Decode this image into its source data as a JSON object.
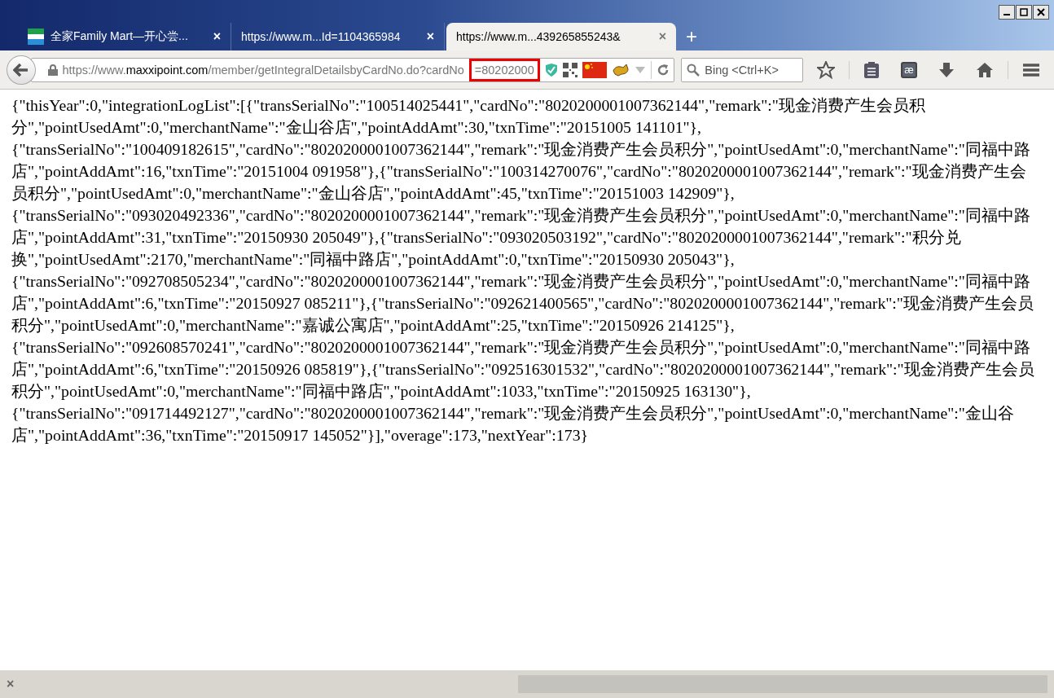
{
  "window": {
    "controls": [
      {
        "kind": "minimize"
      },
      {
        "kind": "maximize"
      },
      {
        "kind": "close"
      }
    ]
  },
  "tabs": [
    {
      "title": "全家Family Mart—开心尝...",
      "close": "×",
      "selected": false,
      "kind": "favicon"
    },
    {
      "title": "https://www.m...Id=1104365984",
      "close": "×",
      "selected": false,
      "kind": "plain"
    },
    {
      "title": "https://www.m...439265855243&",
      "close": "×",
      "selected": true,
      "kind": "plain"
    }
  ],
  "new_tab": "+",
  "address_bar": {
    "scheme": "https://www.",
    "host": "maxxipoint.com",
    "path": "/member/getIntegralDetailsbyCardNo.do?cardNo",
    "highlighted": "=80202000"
  },
  "search": {
    "placeholder": "Bing <Ctrl+K>"
  },
  "toolbar": {
    "addon_glyph": "æ"
  },
  "page_lines": [
    "{\"thisYear\":0,\"integrationLogList\":[{\"transSerialNo\":\"100514025441\",\"cardNo\":\"8020200001007362144\",\"remark\":\"现金消费产生会员积",
    "分\",\"pointUsedAmt\":0,\"merchantName\":\"金山谷店\",\"pointAddAmt\":30,\"txnTime\":\"20151005 141101\"},",
    "{\"transSerialNo\":\"100409182615\",\"cardNo\":\"8020200001007362144\",\"remark\":\"现金消费产生会员积分\",\"pointUsedAmt\":0,\"merchantName\":\"同福中路",
    "店\",\"pointAddAmt\":16,\"txnTime\":\"20151004 091958\"},{\"transSerialNo\":\"100314270076\",\"cardNo\":\"8020200001007362144\",\"remark\":\"现金消费产生会",
    "员积分\",\"pointUsedAmt\":0,\"merchantName\":\"金山谷店\",\"pointAddAmt\":45,\"txnTime\":\"20151003 142909\"},",
    "{\"transSerialNo\":\"093020492336\",\"cardNo\":\"8020200001007362144\",\"remark\":\"现金消费产生会员积分\",\"pointUsedAmt\":0,\"merchantName\":\"同福中路",
    "店\",\"pointAddAmt\":31,\"txnTime\":\"20150930 205049\"},{\"transSerialNo\":\"093020503192\",\"cardNo\":\"8020200001007362144\",\"remark\":\"积分兑",
    "换\",\"pointUsedAmt\":2170,\"merchantName\":\"同福中路店\",\"pointAddAmt\":0,\"txnTime\":\"20150930 205043\"},",
    "{\"transSerialNo\":\"092708505234\",\"cardNo\":\"8020200001007362144\",\"remark\":\"现金消费产生会员积分\",\"pointUsedAmt\":0,\"merchantName\":\"同福中路",
    "店\",\"pointAddAmt\":6,\"txnTime\":\"20150927 085211\"},{\"transSerialNo\":\"092621400565\",\"cardNo\":\"8020200001007362144\",\"remark\":\"现金消费产生会员",
    "积分\",\"pointUsedAmt\":0,\"merchantName\":\"嘉诚公寓店\",\"pointAddAmt\":25,\"txnTime\":\"20150926 214125\"},",
    "{\"transSerialNo\":\"092608570241\",\"cardNo\":\"8020200001007362144\",\"remark\":\"现金消费产生会员积分\",\"pointUsedAmt\":0,\"merchantName\":\"同福中路",
    "店\",\"pointAddAmt\":6,\"txnTime\":\"20150926 085819\"},{\"transSerialNo\":\"092516301532\",\"cardNo\":\"8020200001007362144\",\"remark\":\"现金消费产生会员",
    "积分\",\"pointUsedAmt\":0,\"merchantName\":\"同福中路店\",\"pointAddAmt\":1033,\"txnTime\":\"20150925 163130\"},",
    "{\"transSerialNo\":\"091714492127\",\"cardNo\":\"8020200001007362144\",\"remark\":\"现金消费产生会员积分\",\"pointUsedAmt\":0,\"merchantName\":\"金山谷",
    "店\",\"pointAddAmt\":36,\"txnTime\":\"20150917 145052\"}],\"overage\":173,\"nextYear\":173}"
  ],
  "status_bar": {
    "close": "×"
  }
}
